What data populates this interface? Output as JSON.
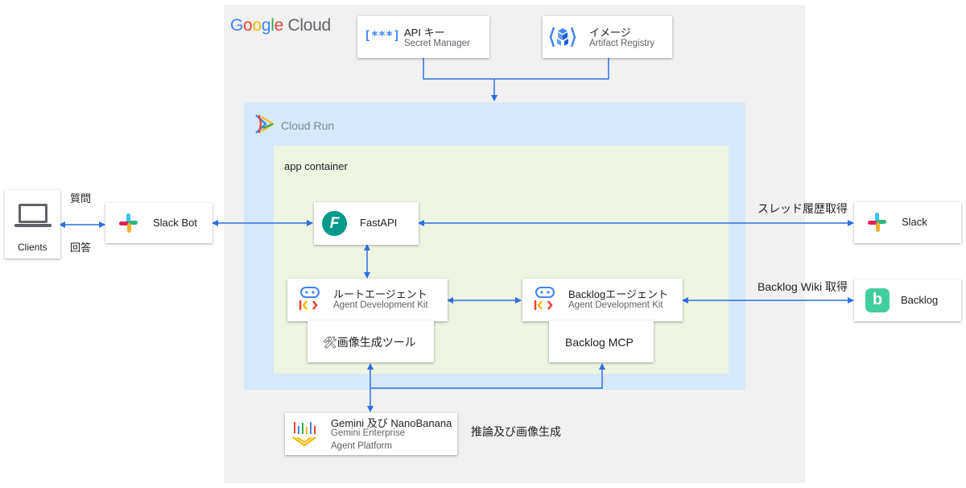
{
  "gcp": {
    "logo_parts": [
      "G",
      "o",
      "o",
      "g",
      "l",
      "e",
      " Cloud"
    ]
  },
  "cloud_run": {
    "label": "Cloud Run"
  },
  "app_container": {
    "label": "app container"
  },
  "secret": {
    "title": "API キー",
    "subtitle": "Secret Manager",
    "icon_text": "[***]"
  },
  "artifact": {
    "title": "イメージ",
    "subtitle": "Artifact Registry"
  },
  "clients": {
    "label": "Clients"
  },
  "slack_bot": {
    "label": "Slack Bot"
  },
  "fastapi": {
    "label": "FastAPI",
    "icon_letter": "F"
  },
  "root_agent": {
    "title": "ルートエージェント",
    "subtitle": "Agent Development Kit"
  },
  "image_tool": {
    "label": "🛠画像生成ツール"
  },
  "backlog_agent": {
    "title": "Backlogエージェント",
    "subtitle": "Agent Development Kit"
  },
  "backlog_mcp": {
    "label": "Backlog MCP"
  },
  "slack_ext": {
    "label": "Slack"
  },
  "backlog_ext": {
    "label": "Backlog",
    "icon_letter": "b"
  },
  "gemini": {
    "title": "Gemini 及び NanoBanana",
    "line2": "Gemini Enterprise",
    "line3": "Agent Platform"
  },
  "edge_labels": {
    "question": "質問",
    "answer": "回答",
    "thread_history": "スレッド履歴取得",
    "backlog_wiki": "Backlog Wiki 取得",
    "inference": "推論及び画像生成"
  },
  "colors": {
    "arrow": "#2d6fe0",
    "gcp_bg": "#f1f1f1",
    "cloud_run_bg": "#d7e9f9",
    "app_bg": "#eef5e3"
  }
}
